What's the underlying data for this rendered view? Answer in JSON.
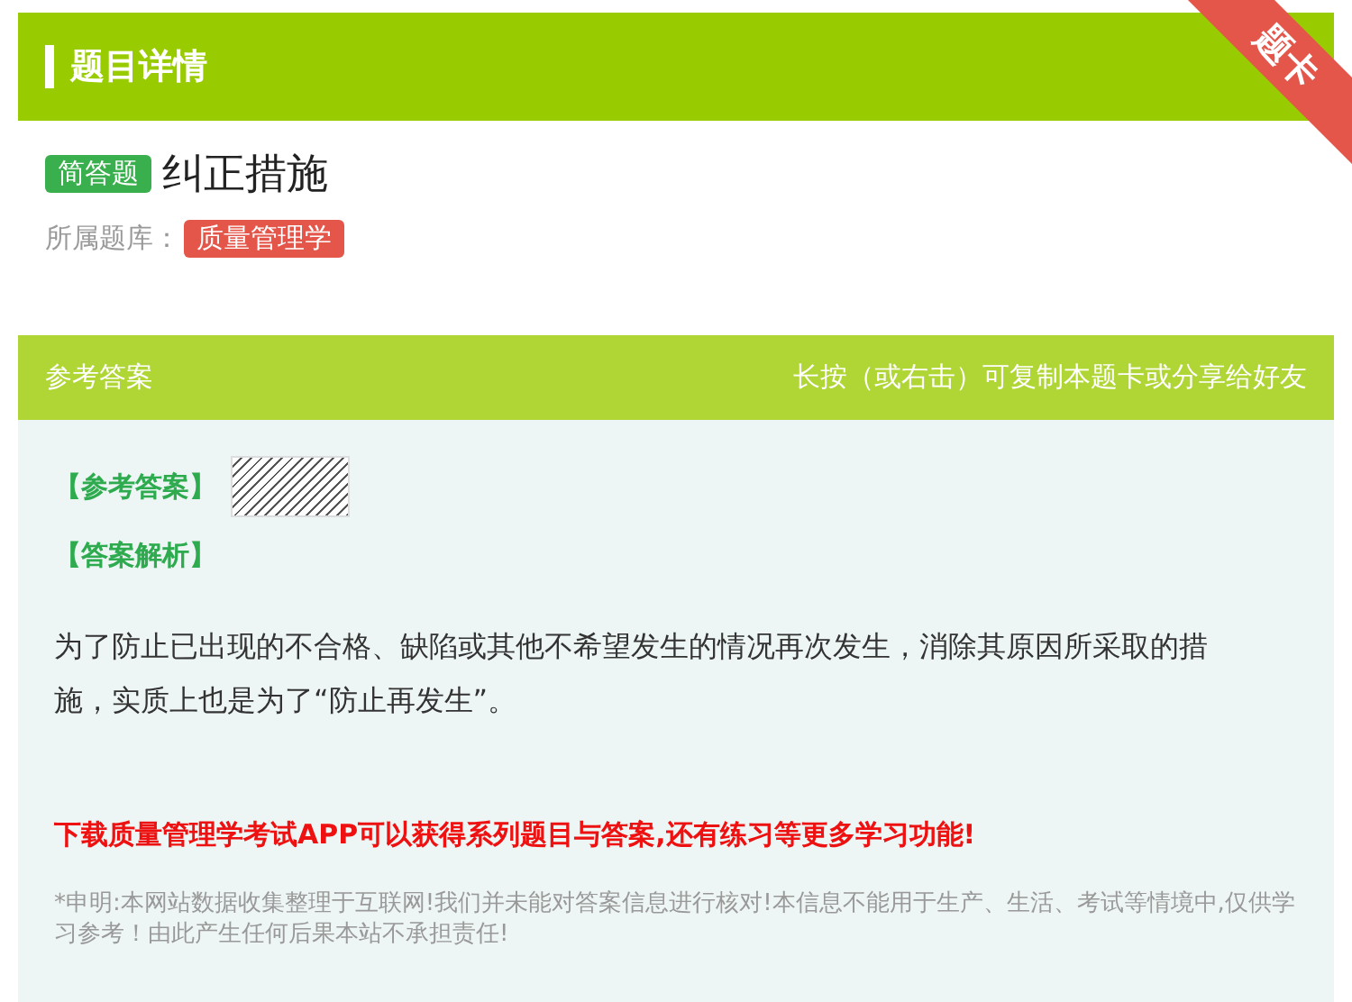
{
  "header": {
    "title": "题目详情",
    "ribbon": "题卡"
  },
  "question": {
    "type_tag": "简答题",
    "title": "纠正措施",
    "library_label": "所属题库：",
    "library": "质量管理学"
  },
  "answer_panel": {
    "title": "参考答案",
    "hint": "长按（或右击）可复制本题卡或分享给好友",
    "answer_label": "【参考答案】",
    "analysis_label": "【答案解析】",
    "analysis": "为了防止已出现的不合格、缺陷或其他不希望发生的情况再次发生，消除其原因所采取的措施，实质上也是为了“防止再发生”。",
    "promo": "下载质量管理学考试APP可以获得系列题目与答案,还有练习等更多学习功能!",
    "disclaimer": "*申明:本网站数据收集整理于互联网!我们并未能对答案信息进行核对!本信息不能用于生产、生活、考试等情境中,仅供学习参考！由此产生任何后果本站不承担责任!"
  }
}
